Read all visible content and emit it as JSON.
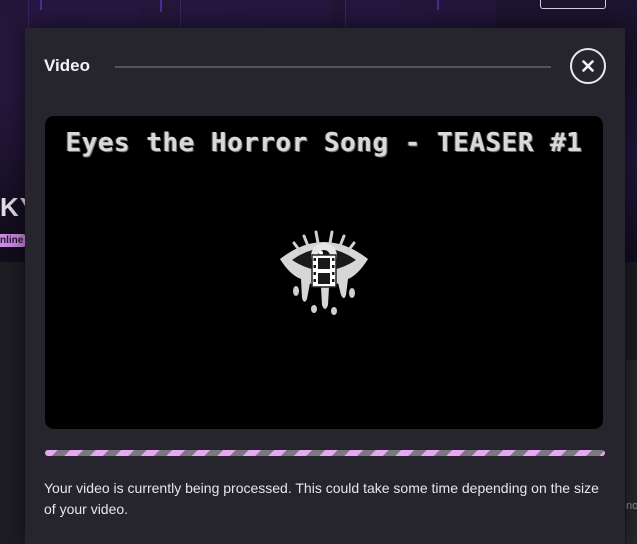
{
  "background": {
    "user_name": "KY",
    "online_badge": "nline",
    "truncated_text": "no"
  },
  "modal": {
    "title": "Video",
    "close_icon": "close-icon",
    "video": {
      "title": "Eyes the Horror Song - TEASER #1",
      "artwork_icon": "dripping-eye-icon",
      "overlay_icon": "film-strip-icon"
    },
    "progress": {
      "state": "processing",
      "style": "indeterminate-striped",
      "colors": [
        "#e7a7f2",
        "#7b7882"
      ]
    },
    "message": "Your video is currently being processed. This could take some time depending on the size of your video."
  },
  "colors": {
    "modal_bg": "#26242c",
    "accent": "#e7a7f2",
    "page_bg": "#17141c"
  }
}
